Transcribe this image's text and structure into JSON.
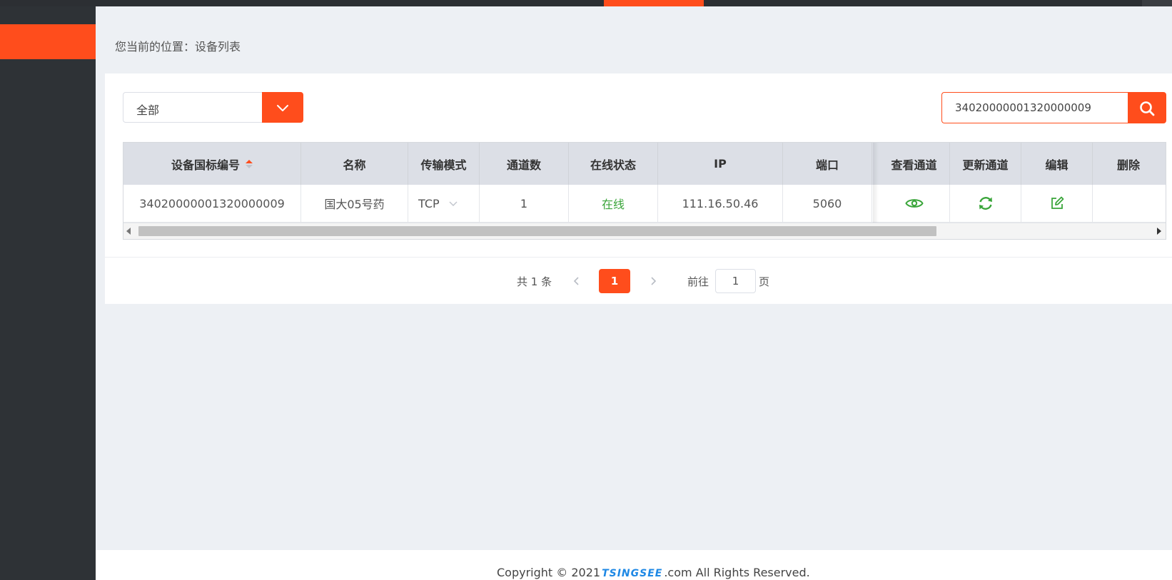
{
  "breadcrumb": {
    "prefix": "您当前的位置：",
    "current": "设备列表"
  },
  "filter": {
    "selected": "全部"
  },
  "search": {
    "value": "34020000001320000009"
  },
  "table": {
    "headers": [
      "设备国标编号",
      "名称",
      "传输模式",
      "通道数",
      "在线状态",
      "IP",
      "端口",
      "查看通道",
      "更新通道",
      "编辑",
      "删除"
    ],
    "rows": [
      {
        "device_id": "34020000001320000009",
        "name": "国大05号药",
        "transport": "TCP",
        "channels": "1",
        "status": "在线",
        "ip": "111.16.50.46",
        "port": "5060"
      }
    ]
  },
  "pagination": {
    "total_text": "共 1 条",
    "current": "1",
    "goto_label": "前往",
    "goto_value": "1",
    "page_label": "页"
  },
  "footer": {
    "prefix": "Copyright © 2021",
    "brand": "TSINGSEE",
    "suffix": ".com All Rights Reserved."
  },
  "colors": {
    "accent": "#ff4d1c",
    "online": "#3aa53a",
    "sidebar": "#2e3236"
  },
  "icons": {
    "select": "chevron-down-icon",
    "search": "search-icon",
    "view": "eye-icon",
    "refresh": "refresh-icon",
    "edit": "edit-icon"
  }
}
